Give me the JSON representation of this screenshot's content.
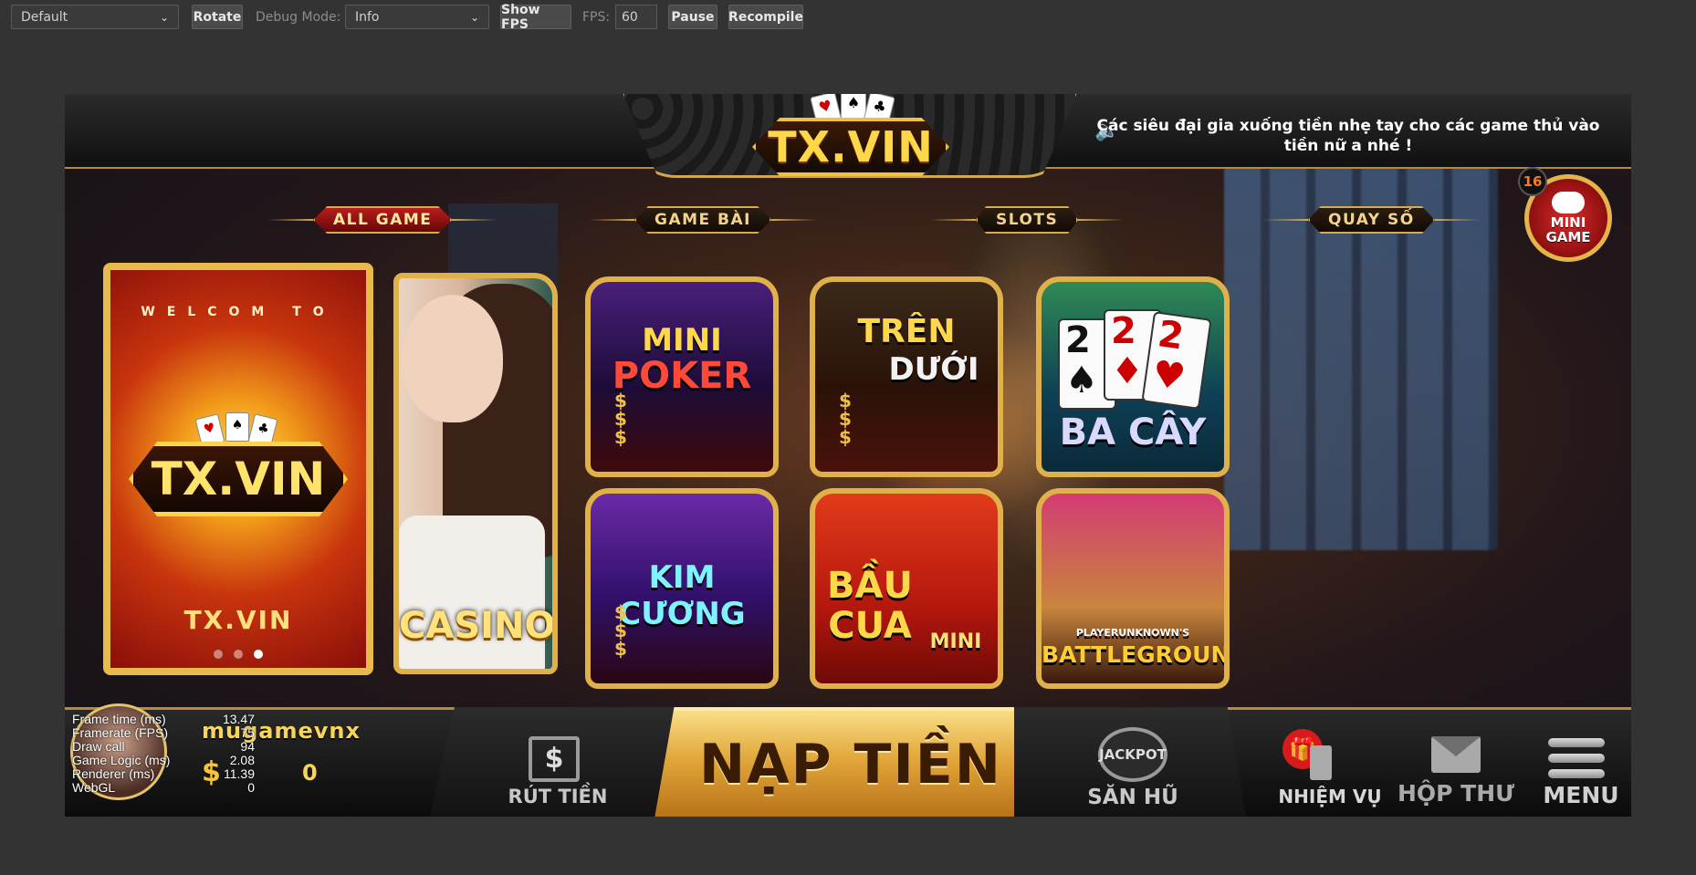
{
  "toolbar": {
    "device_select": "Default",
    "rotate_label": "Rotate",
    "debug_mode_label": "Debug Mode:",
    "debug_mode_value": "Info",
    "show_fps_label": "Show FPS",
    "fps_label": "FPS:",
    "fps_value": "60",
    "pause_label": "Pause",
    "recompile_label": "Recompile"
  },
  "header": {
    "logo_text": "TX.VIN",
    "ticker_text": "Các siêu đại gia xuống tiền nhẹ tay cho các game thủ vào tiền nữ a nhé !",
    "mini_game_label_1": "MINI",
    "mini_game_label_2": "GAME",
    "mini_game_badge": "16"
  },
  "tabs": [
    "ALL GAME",
    "GAME BÀI",
    "SLOTS",
    "QUAY SỐ"
  ],
  "banner": {
    "welcome_text": "WELCOM TO",
    "logo_text": "TX.VIN",
    "bottom_text": "TX.VIN",
    "dots": 3,
    "active_dot": 2
  },
  "casino_label": "CASINO",
  "games": [
    {
      "title_1": "MINI",
      "title_2": "POKER"
    },
    {
      "title_1": "TRÊN",
      "title_2": "DƯỚI"
    },
    {
      "title_1": "BA CÂY"
    },
    {
      "title_1": "KIM CƯƠNG"
    },
    {
      "title_1": "BẦU",
      "title_2": "CUA",
      "title_3": "MINI"
    },
    {
      "title_1": "PLAYERUNKNOWN'S",
      "title_2": "BATTLEGROUNDS"
    }
  ],
  "player": {
    "username": "mugamevnx",
    "currency_icon": "$",
    "balance": "0"
  },
  "stats": [
    {
      "label": "Frame time (ms)",
      "value": "13.47"
    },
    {
      "label": "Framerate (FPS)",
      "value": "75"
    },
    {
      "label": "Draw call",
      "value": "94"
    },
    {
      "label": "Game Logic (ms)",
      "value": "2.08"
    },
    {
      "label": "Renderer (ms)",
      "value": "11.39"
    },
    {
      "label": "WebGL",
      "value": "0"
    }
  ],
  "bottom_nav": {
    "withdraw_label": "RÚT TIỀN",
    "deposit_label": "NẠP TIỀN",
    "jackpot_label": "SĂN HŨ",
    "jackpot_icon_text": "JACKPOT",
    "mission_label": "NHIỆM VỤ",
    "mail_label": "HỘP THƯ",
    "menu_label": "MENU"
  }
}
